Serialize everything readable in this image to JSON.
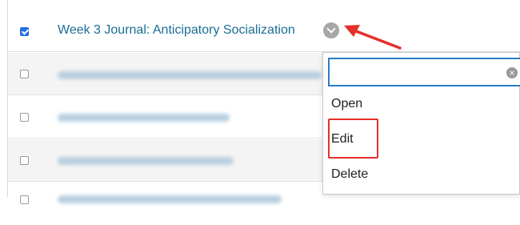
{
  "list": {
    "first_item_title": "Week 3 Journal: Anticipatory Socialization"
  },
  "menu": {
    "items": [
      "Open",
      "Edit",
      "Delete"
    ]
  },
  "colors": {
    "link": "#1a6d96",
    "checkbox_checked": "#1f6fe5",
    "search_focus": "#2b7cc6",
    "annotation": "#e4302b"
  },
  "icons": {
    "item_options": "chevron-down-icon",
    "search_clear": "clear-icon",
    "annotation_arrow": "arrow-icon"
  }
}
